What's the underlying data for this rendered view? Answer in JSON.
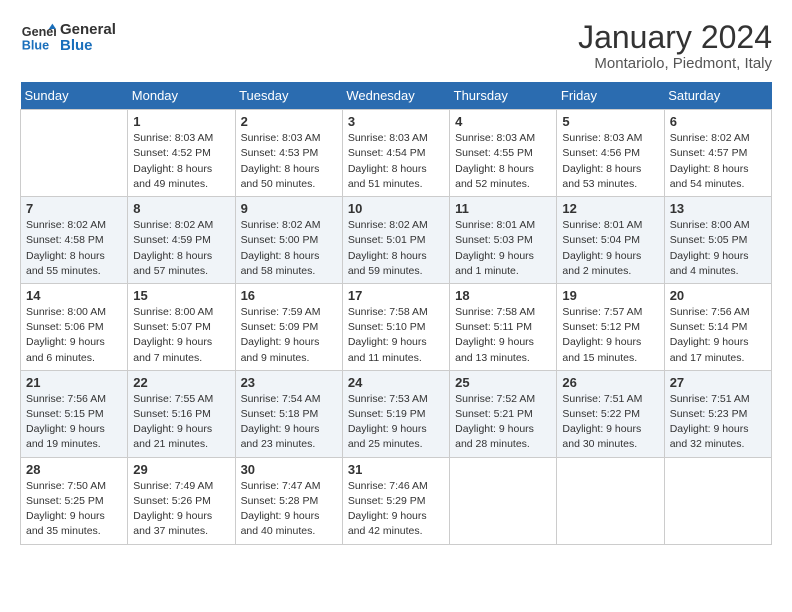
{
  "header": {
    "logo_line1": "General",
    "logo_line2": "Blue",
    "title": "January 2024",
    "subtitle": "Montariolo, Piedmont, Italy"
  },
  "days_of_week": [
    "Sunday",
    "Monday",
    "Tuesday",
    "Wednesday",
    "Thursday",
    "Friday",
    "Saturday"
  ],
  "weeks": [
    [
      {
        "num": "",
        "info": ""
      },
      {
        "num": "1",
        "info": "Sunrise: 8:03 AM\nSunset: 4:52 PM\nDaylight: 8 hours\nand 49 minutes."
      },
      {
        "num": "2",
        "info": "Sunrise: 8:03 AM\nSunset: 4:53 PM\nDaylight: 8 hours\nand 50 minutes."
      },
      {
        "num": "3",
        "info": "Sunrise: 8:03 AM\nSunset: 4:54 PM\nDaylight: 8 hours\nand 51 minutes."
      },
      {
        "num": "4",
        "info": "Sunrise: 8:03 AM\nSunset: 4:55 PM\nDaylight: 8 hours\nand 52 minutes."
      },
      {
        "num": "5",
        "info": "Sunrise: 8:03 AM\nSunset: 4:56 PM\nDaylight: 8 hours\nand 53 minutes."
      },
      {
        "num": "6",
        "info": "Sunrise: 8:02 AM\nSunset: 4:57 PM\nDaylight: 8 hours\nand 54 minutes."
      }
    ],
    [
      {
        "num": "7",
        "info": "Sunrise: 8:02 AM\nSunset: 4:58 PM\nDaylight: 8 hours\nand 55 minutes."
      },
      {
        "num": "8",
        "info": "Sunrise: 8:02 AM\nSunset: 4:59 PM\nDaylight: 8 hours\nand 57 minutes."
      },
      {
        "num": "9",
        "info": "Sunrise: 8:02 AM\nSunset: 5:00 PM\nDaylight: 8 hours\nand 58 minutes."
      },
      {
        "num": "10",
        "info": "Sunrise: 8:02 AM\nSunset: 5:01 PM\nDaylight: 8 hours\nand 59 minutes."
      },
      {
        "num": "11",
        "info": "Sunrise: 8:01 AM\nSunset: 5:03 PM\nDaylight: 9 hours\nand 1 minute."
      },
      {
        "num": "12",
        "info": "Sunrise: 8:01 AM\nSunset: 5:04 PM\nDaylight: 9 hours\nand 2 minutes."
      },
      {
        "num": "13",
        "info": "Sunrise: 8:00 AM\nSunset: 5:05 PM\nDaylight: 9 hours\nand 4 minutes."
      }
    ],
    [
      {
        "num": "14",
        "info": "Sunrise: 8:00 AM\nSunset: 5:06 PM\nDaylight: 9 hours\nand 6 minutes."
      },
      {
        "num": "15",
        "info": "Sunrise: 8:00 AM\nSunset: 5:07 PM\nDaylight: 9 hours\nand 7 minutes."
      },
      {
        "num": "16",
        "info": "Sunrise: 7:59 AM\nSunset: 5:09 PM\nDaylight: 9 hours\nand 9 minutes."
      },
      {
        "num": "17",
        "info": "Sunrise: 7:58 AM\nSunset: 5:10 PM\nDaylight: 9 hours\nand 11 minutes."
      },
      {
        "num": "18",
        "info": "Sunrise: 7:58 AM\nSunset: 5:11 PM\nDaylight: 9 hours\nand 13 minutes."
      },
      {
        "num": "19",
        "info": "Sunrise: 7:57 AM\nSunset: 5:12 PM\nDaylight: 9 hours\nand 15 minutes."
      },
      {
        "num": "20",
        "info": "Sunrise: 7:56 AM\nSunset: 5:14 PM\nDaylight: 9 hours\nand 17 minutes."
      }
    ],
    [
      {
        "num": "21",
        "info": "Sunrise: 7:56 AM\nSunset: 5:15 PM\nDaylight: 9 hours\nand 19 minutes."
      },
      {
        "num": "22",
        "info": "Sunrise: 7:55 AM\nSunset: 5:16 PM\nDaylight: 9 hours\nand 21 minutes."
      },
      {
        "num": "23",
        "info": "Sunrise: 7:54 AM\nSunset: 5:18 PM\nDaylight: 9 hours\nand 23 minutes."
      },
      {
        "num": "24",
        "info": "Sunrise: 7:53 AM\nSunset: 5:19 PM\nDaylight: 9 hours\nand 25 minutes."
      },
      {
        "num": "25",
        "info": "Sunrise: 7:52 AM\nSunset: 5:21 PM\nDaylight: 9 hours\nand 28 minutes."
      },
      {
        "num": "26",
        "info": "Sunrise: 7:51 AM\nSunset: 5:22 PM\nDaylight: 9 hours\nand 30 minutes."
      },
      {
        "num": "27",
        "info": "Sunrise: 7:51 AM\nSunset: 5:23 PM\nDaylight: 9 hours\nand 32 minutes."
      }
    ],
    [
      {
        "num": "28",
        "info": "Sunrise: 7:50 AM\nSunset: 5:25 PM\nDaylight: 9 hours\nand 35 minutes."
      },
      {
        "num": "29",
        "info": "Sunrise: 7:49 AM\nSunset: 5:26 PM\nDaylight: 9 hours\nand 37 minutes."
      },
      {
        "num": "30",
        "info": "Sunrise: 7:47 AM\nSunset: 5:28 PM\nDaylight: 9 hours\nand 40 minutes."
      },
      {
        "num": "31",
        "info": "Sunrise: 7:46 AM\nSunset: 5:29 PM\nDaylight: 9 hours\nand 42 minutes."
      },
      {
        "num": "",
        "info": ""
      },
      {
        "num": "",
        "info": ""
      },
      {
        "num": "",
        "info": ""
      }
    ]
  ]
}
